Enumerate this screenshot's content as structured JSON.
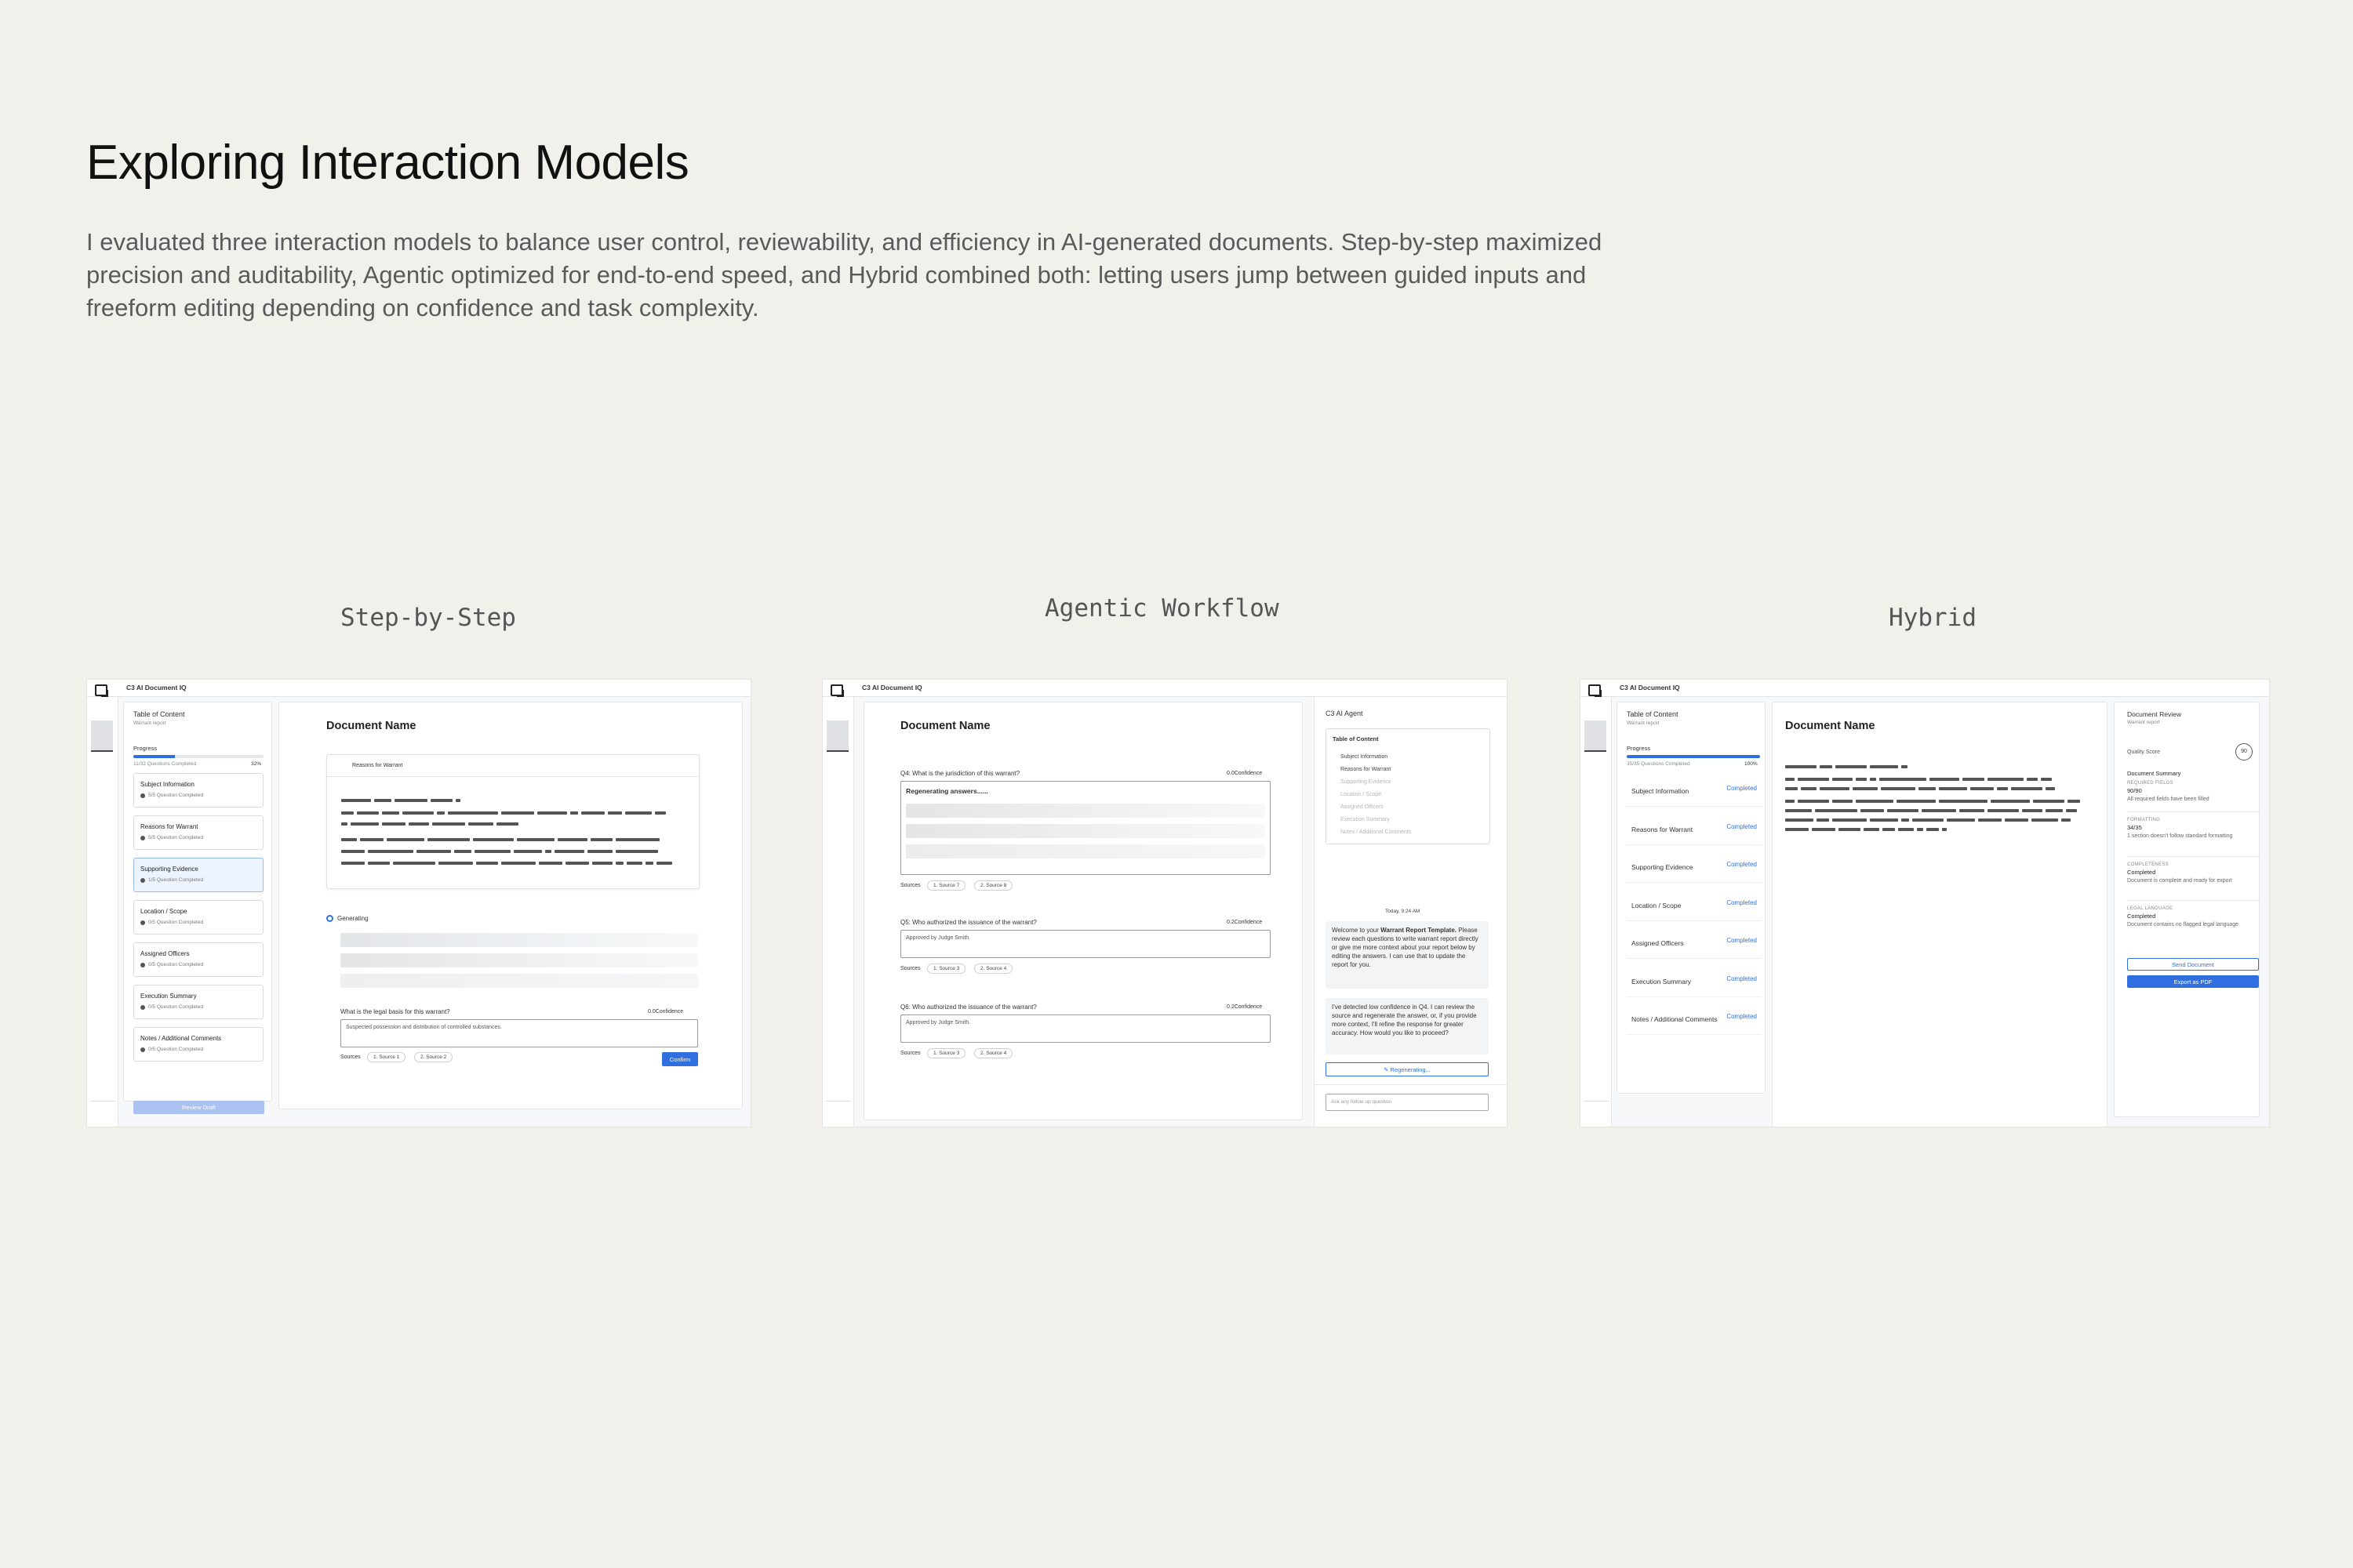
{
  "page": {
    "title": "Exploring Interaction Models",
    "intro": "I evaluated three interaction models to balance user control, reviewability, and efficiency in AI-generated documents. Step-by-step maximized precision and auditability, Agentic optimized for end-to-end speed, and Hybrid combined both: letting users jump between guided inputs and freeform editing depending on confidence and task complexity.",
    "captions": [
      "Step-by-Step",
      "Agentic Workflow",
      "Hybrid"
    ]
  },
  "app": {
    "title": "C3 AI Document IQ",
    "logo_icon": "document-iq-logo-icon"
  },
  "step": {
    "toc_title": "Table of Content",
    "toc_sub": "Warrant report",
    "progress_label": "Progress",
    "progress_count": "11/32 Questions Completed",
    "progress_pct": "32%",
    "progress_value": 0.32,
    "steps": [
      {
        "name": "Subject Information",
        "status": "5/5 Question Completed"
      },
      {
        "name": "Reasons for Warrant",
        "status": "5/5 Question Completed"
      },
      {
        "name": "Supporting Evidence",
        "status": "1/5 Question Completed"
      },
      {
        "name": "Location / Scope",
        "status": "0/5 Question Completed"
      },
      {
        "name": "Assigned Officers",
        "status": "0/5 Question Completed"
      },
      {
        "name": "Execution Summary",
        "status": "0/5 Question Completed"
      },
      {
        "name": "Notes / Additional Comments",
        "status": "0/5 Question Completed"
      }
    ],
    "review_button": "Review Draft",
    "doc_name": "Document Name",
    "section_title": "Reasons for Warrant",
    "generating": "Generating",
    "question": "What is the legal basis for this warrant?",
    "confidence_num": "0.0",
    "confidence_label": "Confidence",
    "answer": "Suspected possession and distribution of controlled substances.",
    "sources_label": "Sources",
    "sources": [
      "1. Source 1",
      "2. Source 2"
    ],
    "confirm_button": "Confirm"
  },
  "agentic": {
    "doc_name": "Document Name",
    "q4": "Q4: What is the jurisdiction of this warrant?",
    "q4_conf": "0.0",
    "regenerating_text": "Regenerating answers......",
    "q4_sources": [
      "1. Source 7",
      "2. Source 8"
    ],
    "q5": "Q5: Who authorized the issuance of the warrant?",
    "q5_conf": "0.2",
    "q5_answer": "Approved by Judge Smith.",
    "q5_sources": [
      "1. Source 3",
      "2. Source 4"
    ],
    "q6": "Q6: Who authorized the issuance of the warrant?",
    "q6_conf": "0.2",
    "q6_answer": "Approved by Judge Smith.",
    "q6_sources": [
      "1. Source 3",
      "2. Source 4"
    ],
    "confidence_label": "Confidence",
    "sources_label": "Sources",
    "agent_title": "C3 AI Agent",
    "toc_title": "Table of Content",
    "toc_items": [
      {
        "label": "Subject Information",
        "done": true
      },
      {
        "label": "Reasons for Warrant",
        "done": true
      },
      {
        "label": "Supporting Evidence",
        "done": false
      },
      {
        "label": "Location / Scope",
        "done": false
      },
      {
        "label": "Assigned Officers",
        "done": false
      },
      {
        "label": "Execution Summary",
        "done": false
      },
      {
        "label": "Notes / Additional Comments",
        "done": false
      }
    ],
    "timestamp": "Today, 9:24 AM",
    "msg1_pre": "Welcome to your ",
    "msg1_bold": "Warrant Report Template.",
    "msg1_post": "Please review each questions to write warrant report directly or give me more context about your report below by editing the answers. I can use that to update the report for you.",
    "msg2": "I've detected low confidence in Q4. I can review the source and regenerate the answer, or, if you provide more context, I'll refine the response for greater accuracy. How would you like to proceed?",
    "regenerating_button": "Regenerating...",
    "followup_placeholder": "Ask any follow up question"
  },
  "hybrid": {
    "toc_title": "Table of Content",
    "toc_sub": "Warrant report",
    "progress_label": "Progress",
    "progress_count": "35/35 Questions Completed",
    "progress_pct": "100%",
    "progress_value": 1.0,
    "sections": [
      "Subject Information",
      "Reasons for Warrant",
      "Supporting Evidence",
      "Location / Scope",
      "Assigned Officers",
      "Execution Summary",
      "Notes / Additional Comments"
    ],
    "status_completed": "Completed",
    "doc_name": "Document Name",
    "review_title": "Document Review",
    "review_sub": "Warrant report",
    "quality_label": "Quality Score",
    "quality_score": "90",
    "summary_title": "Document Summary",
    "required_label": "REQUIRED FIELDS",
    "required_value": "90/90",
    "required_note": "All required fields have been filled",
    "formatting_label": "FORMATTING",
    "formatting_value": "34/35",
    "formatting_note": "1 section doesn't follow standard formatting",
    "completeness_label": "COMPLETENESS",
    "completeness_value": "Completed",
    "completeness_note": "Document is complete and ready for export",
    "legal_label": "LEGAL LANGUAGE",
    "legal_value": "Completed",
    "legal_note": "Document contains no flagged legal language",
    "send_button": "Send Document",
    "export_button": "Export as PDF"
  }
}
